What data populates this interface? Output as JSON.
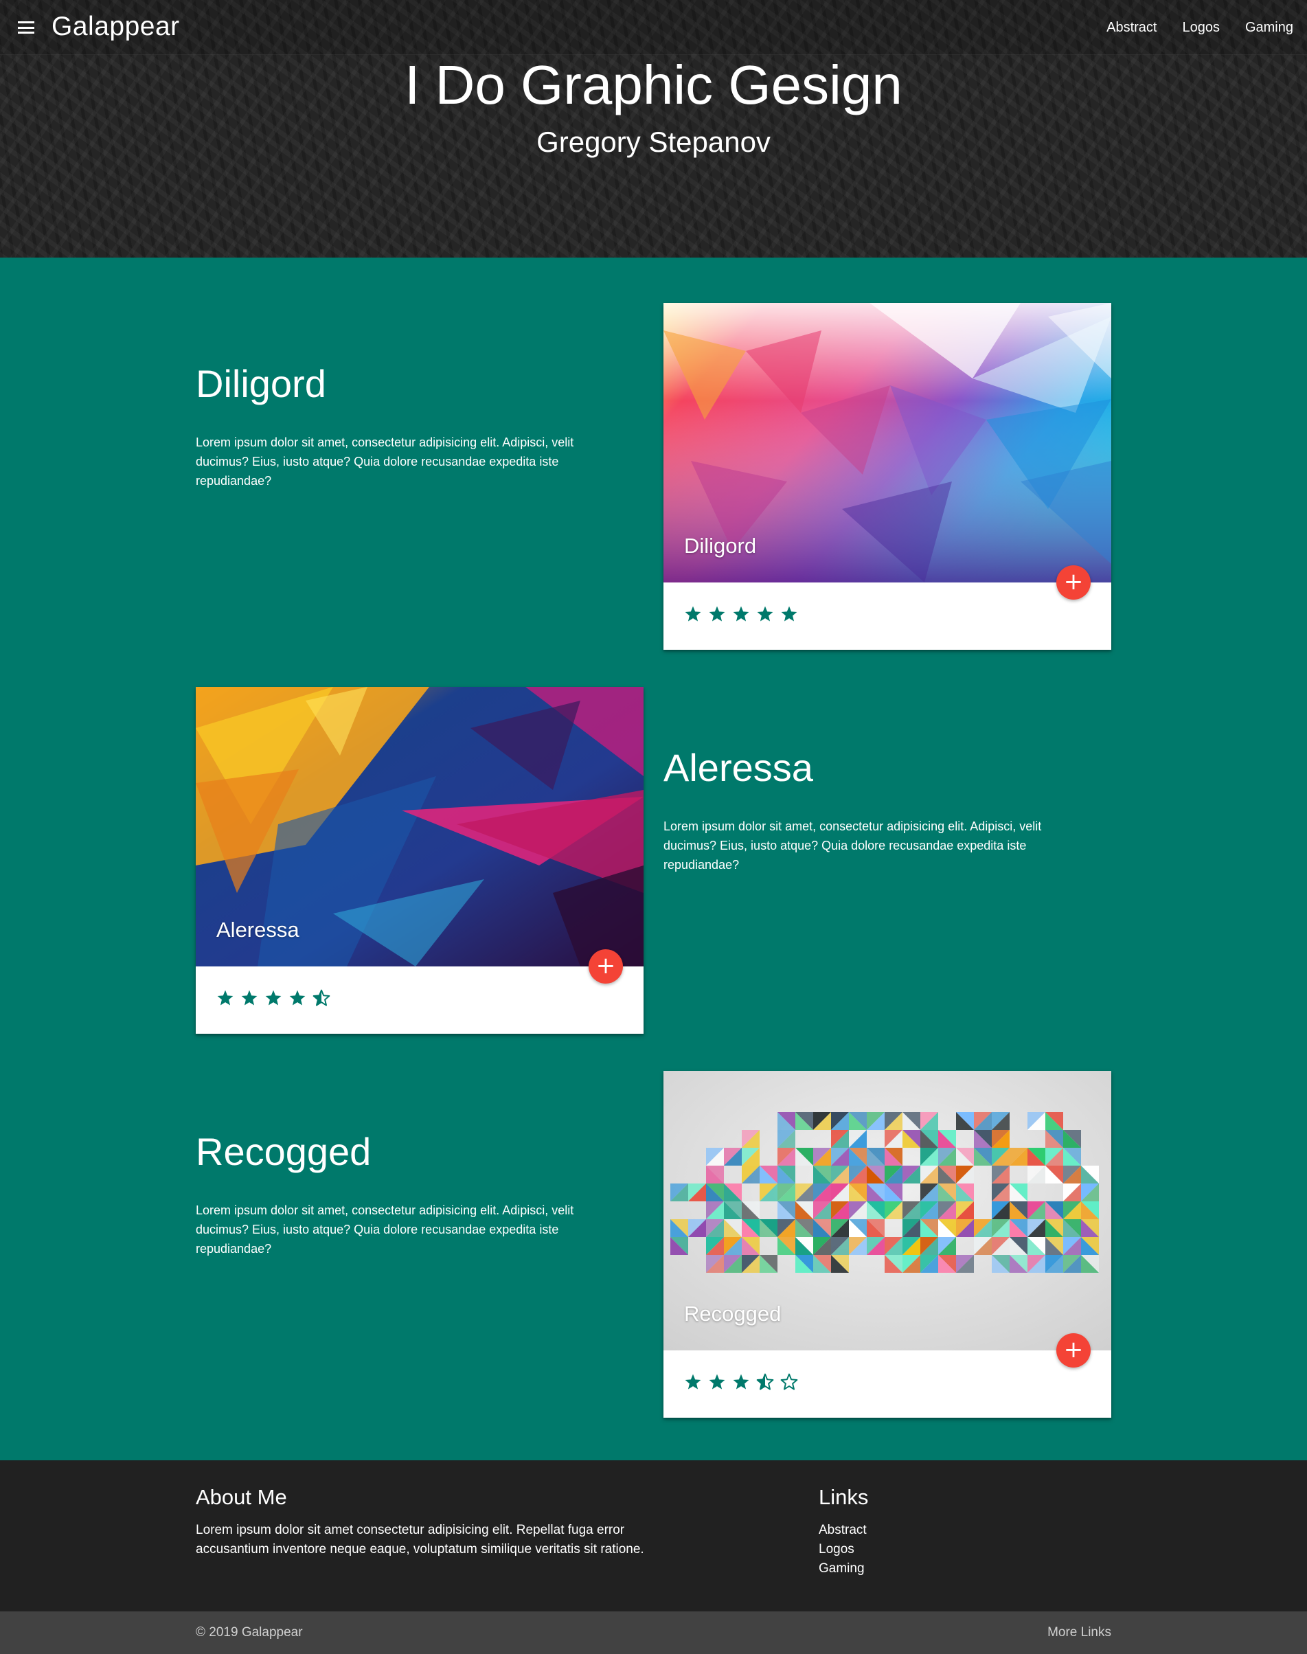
{
  "nav": {
    "brand": "Galappear",
    "links": [
      "Abstract",
      "Logos",
      "Gaming"
    ]
  },
  "hero": {
    "title": "I Do Graphic Gesign",
    "subtitle": "Gregory Stepanov"
  },
  "items": [
    {
      "title": "Diligord",
      "text": "Lorem ipsum dolor sit amet, consectetur adipisicing elit. Adipisci, velit ducimus? Eius, iusto atque? Quia dolore recusandae expedita iste repudiandae?",
      "caption": "Diligord",
      "rating": 5,
      "max_rating": 5,
      "add_button": "+"
    },
    {
      "title": "Aleressa",
      "text": "Lorem ipsum dolor sit amet, consectetur adipisicing elit. Adipisci, velit ducimus? Eius, iusto atque? Quia dolore recusandae expedita iste repudiandae?",
      "caption": "Aleressa",
      "rating": 4.5,
      "max_rating": 5,
      "add_button": "+"
    },
    {
      "title": "Recogged",
      "text": "Lorem ipsum dolor sit amet, consectetur adipisicing elit. Adipisci, velit ducimus? Eius, iusto atque? Quia dolore recusandae expedita iste repudiandae?",
      "caption": "Recogged",
      "rating": 3.5,
      "max_rating": 5,
      "add_button": "+"
    }
  ],
  "footer": {
    "about_title": "About Me",
    "about_text": "Lorem ipsum dolor sit amet consectetur adipisicing elit. Repellat fuga error accusantium inventore neque eaque, voluptatum similique veritatis sit ratione.",
    "links_title": "Links",
    "links": [
      "Abstract",
      "Logos",
      "Gaming"
    ],
    "copyright": "© 2019 Galappear",
    "more_links": "More Links"
  },
  "colors": {
    "accent": "#00796b",
    "star": "#00796b",
    "fab": "#f44336",
    "header_bg": "#252525",
    "footer_bg": "#212121",
    "copyright_bg": "#424242"
  }
}
